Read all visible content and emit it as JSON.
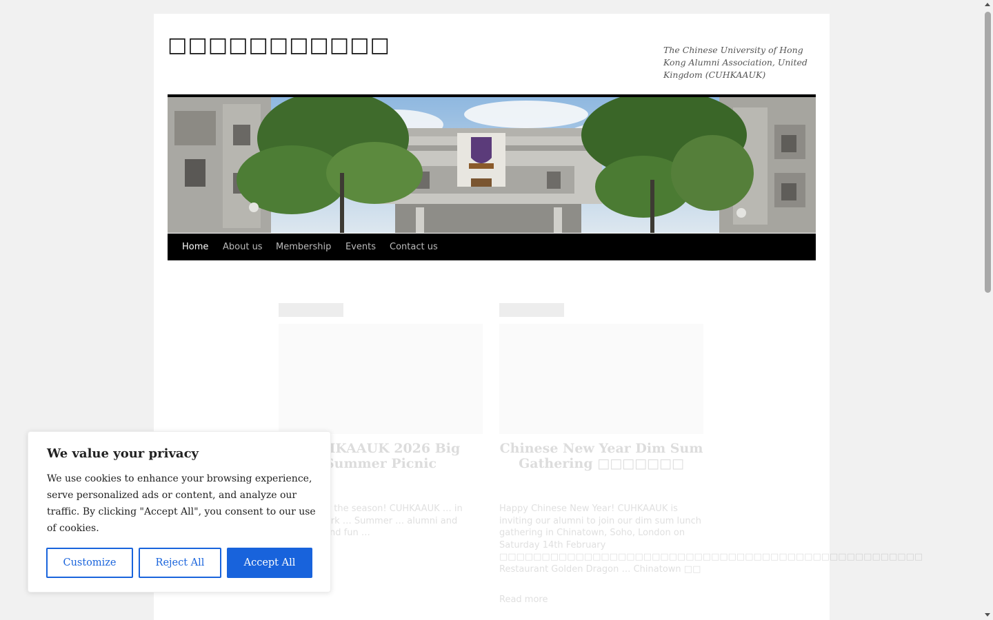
{
  "site": {
    "title": "□□□□□□□□□□□",
    "description": "The Chinese University of Hong Kong Alumni Association, United Kingdom (CUHKAAUK)"
  },
  "banner": {
    "image": "cuhk-campus-building-with-emblem-photo"
  },
  "nav": {
    "items": [
      {
        "label": "Home",
        "active": true
      },
      {
        "label": "About us",
        "active": false
      },
      {
        "label": "Membership",
        "active": false
      },
      {
        "label": "Events",
        "active": false
      },
      {
        "label": "Contact us",
        "active": false
      }
    ]
  },
  "posts": [
    {
      "category": "",
      "title": "CUHKAAUK 2026 Big Summer Picnic",
      "meta": "",
      "excerpt": "… ready for the season! CUHKAAUK … in Regent's Park … Summer … alumni and friends … and fun …",
      "read_more": "Read more"
    },
    {
      "category": "",
      "title": "Chinese New Year Dim Sum Gathering □□□□□□□",
      "meta": "",
      "excerpt": "Happy Chinese New Year! CUHKAAUK is inviting our alumni to join our dim sum lunch gathering in Chinatown, Soho, London on Saturday 14th February □□□□□□□□□□□□□□□□□□□□□□□□□□□□□□□□□□□□□□□□□□□□□□□□□□ Restaurant Golden Dragon … Chinatown □□",
      "read_more": "Read more"
    }
  ],
  "cookie_banner": {
    "title": "We value your privacy",
    "text": "We use cookies to enhance your browsing experience, serve personalized ads or content, and analyze our traffic. By clicking \"Accept All\", you consent to our use of cookies.",
    "customize": "Customize",
    "reject": "Reject All",
    "accept": "Accept All"
  },
  "colors": {
    "accent": "#1863dc",
    "nav_bg": "#000000",
    "page_bg": "#f1f1f1"
  }
}
